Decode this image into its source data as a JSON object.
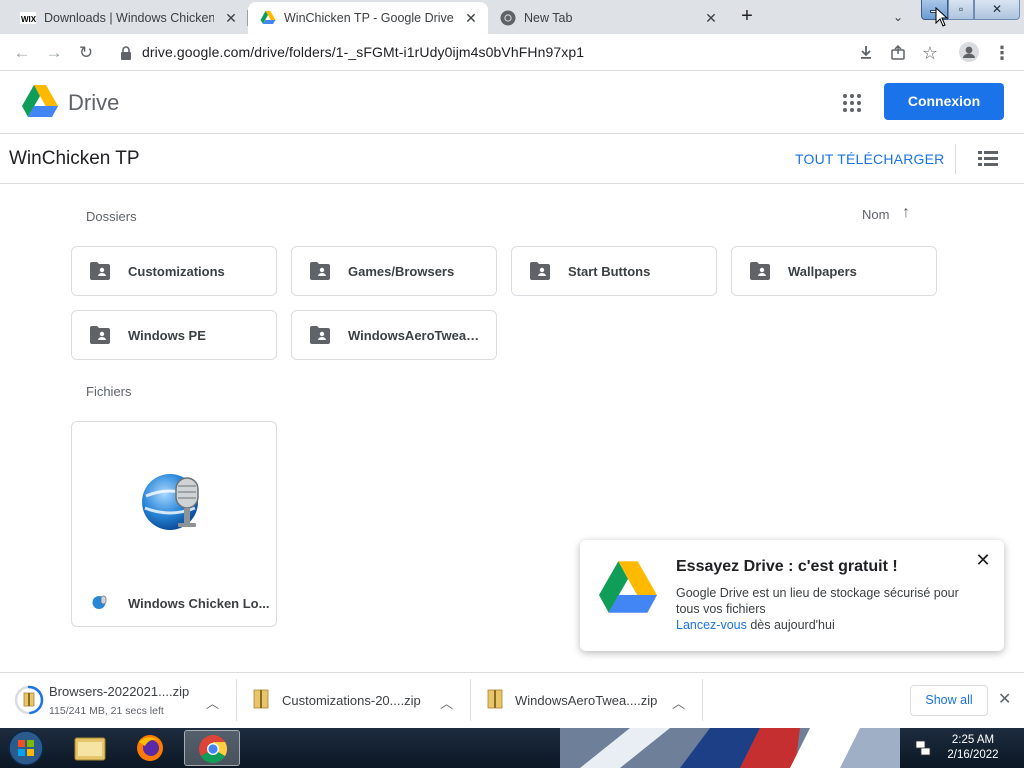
{
  "browser": {
    "tabs": [
      {
        "title": "Downloads | Windows Chicken",
        "favicon": "wix-icon",
        "active": false
      },
      {
        "title": "WinChicken TP - Google Drive",
        "favicon": "google-drive-icon",
        "active": true
      },
      {
        "title": "New Tab",
        "favicon": "chrome-icon",
        "active": false
      }
    ],
    "new_tab_label": "+",
    "url": "drive.google.com/drive/folders/1-_sFGMt-i1rUdy0ijm4s0bVhFHn97xp1"
  },
  "drive": {
    "product_name": "Drive",
    "signin_label": "Connexion",
    "folder_title": "WinChicken TP",
    "download_all_label": "TOUT TÉLÉCHARGER",
    "sort_label": "Nom",
    "sections": {
      "folders": "Dossiers",
      "files": "Fichiers"
    },
    "folders": [
      "Customizations",
      "Games/Browsers",
      "Start Buttons",
      "Wallpapers",
      "Windows PE",
      "WindowsAeroTweake..."
    ],
    "files": [
      {
        "name": "Windows Chicken Lo..."
      }
    ],
    "colors": {
      "accent": "#1a73e8",
      "folder_icon": "#5f6368"
    }
  },
  "promo": {
    "title": "Essayez Drive : c'est gratuit !",
    "body": "Google Drive est un lieu de stockage sécurisé pour tous vos fichiers",
    "link": "Lancez-vous",
    "link_suffix": " dès aujourd'hui"
  },
  "downloads": {
    "items": [
      {
        "name": "Browsers-2022021....zip",
        "status": "115/241 MB, 21 secs left",
        "progress_percent": 48
      },
      {
        "name": "Customizations-20....zip"
      },
      {
        "name": "WindowsAeroTwea....zip"
      }
    ],
    "show_all_label": "Show all"
  },
  "taskbar": {
    "time": "2:25 AM",
    "date": "2/16/2022"
  }
}
